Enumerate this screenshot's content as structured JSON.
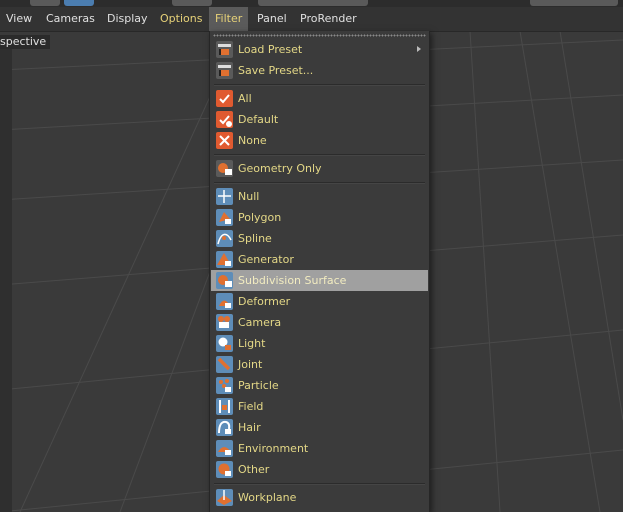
{
  "viewport": {
    "label": "spective"
  },
  "menubar": {
    "items": [
      {
        "label": "View"
      },
      {
        "label": "Cameras"
      },
      {
        "label": "Display"
      },
      {
        "label": "Options"
      },
      {
        "label": "Filter"
      },
      {
        "label": "Panel"
      },
      {
        "label": "ProRender"
      }
    ],
    "active_item": "Filter"
  },
  "filter_menu": {
    "items": [
      {
        "label": "Load Preset",
        "icon": "load-preset-icon",
        "submenu": true
      },
      {
        "label": "Save Preset...",
        "icon": "save-preset-icon"
      },
      {
        "label": "All",
        "icon": "checkmark-icon"
      },
      {
        "label": "Default",
        "icon": "checkmark-default-icon"
      },
      {
        "label": "None",
        "icon": "x-mark-icon"
      },
      {
        "label": "Geometry Only",
        "icon": "geometry-only-icon"
      },
      {
        "label": "Null",
        "icon": "null-icon"
      },
      {
        "label": "Polygon",
        "icon": "polygon-icon"
      },
      {
        "label": "Spline",
        "icon": "spline-icon"
      },
      {
        "label": "Generator",
        "icon": "generator-icon"
      },
      {
        "label": "Subdivision Surface",
        "icon": "subdivision-surface-icon",
        "highlighted": true
      },
      {
        "label": "Deformer",
        "icon": "deformer-icon"
      },
      {
        "label": "Camera",
        "icon": "camera-icon"
      },
      {
        "label": "Light",
        "icon": "light-icon"
      },
      {
        "label": "Joint",
        "icon": "joint-icon"
      },
      {
        "label": "Particle",
        "icon": "particle-icon"
      },
      {
        "label": "Field",
        "icon": "field-icon"
      },
      {
        "label": "Hair",
        "icon": "hair-icon"
      },
      {
        "label": "Environment",
        "icon": "environment-icon"
      },
      {
        "label": "Other",
        "icon": "other-icon"
      },
      {
        "label": "Workplane",
        "icon": "workplane-icon"
      }
    ]
  },
  "colors": {
    "menu_text": "#e4d887",
    "highlight_row": "#a0a0a0",
    "checkbox_red": "#e05a30",
    "icon_blue": "#5e8db8"
  }
}
